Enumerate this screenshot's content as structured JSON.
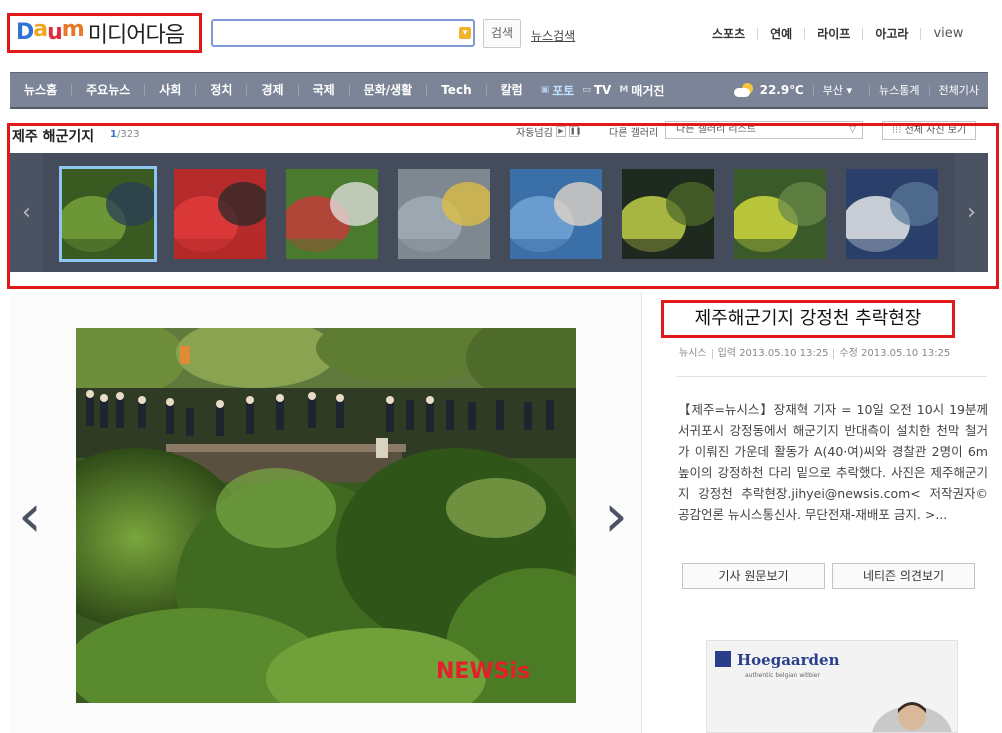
{
  "header": {
    "logo_letters": [
      {
        "ch": "D",
        "color": "#2f73d4"
      },
      {
        "ch": "a",
        "color": "#f2a51e"
      },
      {
        "ch": "u",
        "color": "#e02d3c"
      },
      {
        "ch": "m",
        "color": "#e8772a"
      }
    ],
    "logo_sub": "미디어다음",
    "search_placeholder": "",
    "search_button": "검색",
    "news_search": "뉴스검색",
    "top_links": [
      "스포츠",
      "연예",
      "라이프",
      "아고라",
      "view"
    ]
  },
  "nav": {
    "items": [
      "뉴스홈",
      "주요뉴스",
      "사회",
      "정치",
      "경제",
      "국제",
      "문화/생활",
      "Tech",
      "칼럼"
    ],
    "media": [
      {
        "icon": "photo-icon",
        "label": "포토",
        "active": true
      },
      {
        "icon": "tv-icon",
        "label": "TV",
        "active": false
      },
      {
        "icon": "magazine-icon",
        "label": "매거진",
        "active": false
      }
    ],
    "weather": {
      "temp": "22.9℃",
      "city": "부산"
    },
    "right_links": [
      "뉴스통계",
      "전체기사"
    ]
  },
  "gallery": {
    "title": "제주 해군기지",
    "current": "1",
    "total": "/323",
    "autoplay_label": "자동넘김",
    "other_label": "다른 갤러리",
    "other_select": "다른 갤러리 리스트",
    "all_photos": "전체 사진 보기",
    "thumb_count": 8
  },
  "article": {
    "title": "제주해군기지 강정천 추락현장",
    "source": "뉴시스",
    "posted": "입력 2013.05.10 13:25",
    "modified": "수정 2013.05.10 13:25",
    "body": "【제주=뉴시스】장재혁 기자 = 10일 오전 10시 19분께 서귀포시 강정동에서 해군기지 반대측이 설치한 천막 철거가 이뤄진 가운데 활동가 A(40·여)씨와 경찰관 2명이 6m 높이의 강정하천 다리 밑으로 추락했다. 사진은 제주해군기지 강정천 추락현장.jihyei@newsis.com< 저작권자© 공감언론 뉴시스통신사. 무단전재-재배포 금지. >...",
    "btn_original": "기사 원문보기",
    "btn_comments": "네티즌 의견보기"
  },
  "photo_watermark": "NEWSis",
  "ad": {
    "brand": "Hoegaarden",
    "tagline": "authentic belgian witbier"
  }
}
